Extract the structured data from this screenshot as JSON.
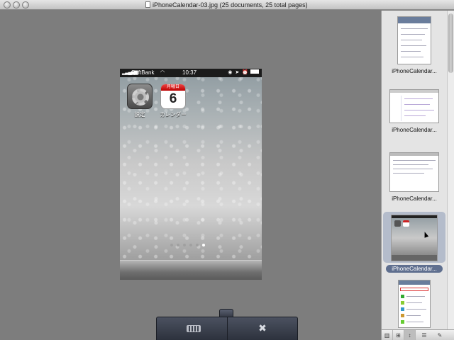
{
  "window": {
    "title": "iPhoneCalendar-03.jpg (25 documents, 25 total pages)"
  },
  "phone": {
    "carrier": "SoftBank",
    "time": "10:37",
    "apps": [
      {
        "label": "設定",
        "icon": "settings-gear-icon"
      },
      {
        "label": "カレンダー",
        "icon": "calendar-icon",
        "weekday": "月曜日",
        "day": "6"
      }
    ],
    "page_count": 6,
    "current_page": 6
  },
  "sidebar": {
    "thumbnails": [
      {
        "label": "iPhoneCalendar...",
        "selected": false
      },
      {
        "label": "iPhoneCalendar...",
        "selected": false
      },
      {
        "label": "iPhoneCalendar...",
        "selected": false
      },
      {
        "label": "iPhoneCalendar...",
        "selected": true
      },
      {
        "label": "",
        "selected": false
      }
    ]
  },
  "sidebar_footer": {
    "buttons": [
      "list-view-icon",
      "grid-view-icon",
      "sort-icon",
      "list-icon",
      "pencil-icon"
    ]
  },
  "hud": {
    "buttons": [
      "keyboard-icon",
      "tools-icon"
    ]
  },
  "colors": {
    "background": "#7d7d7d",
    "selection": "#5f6f8f",
    "hud": "#2d323d"
  }
}
